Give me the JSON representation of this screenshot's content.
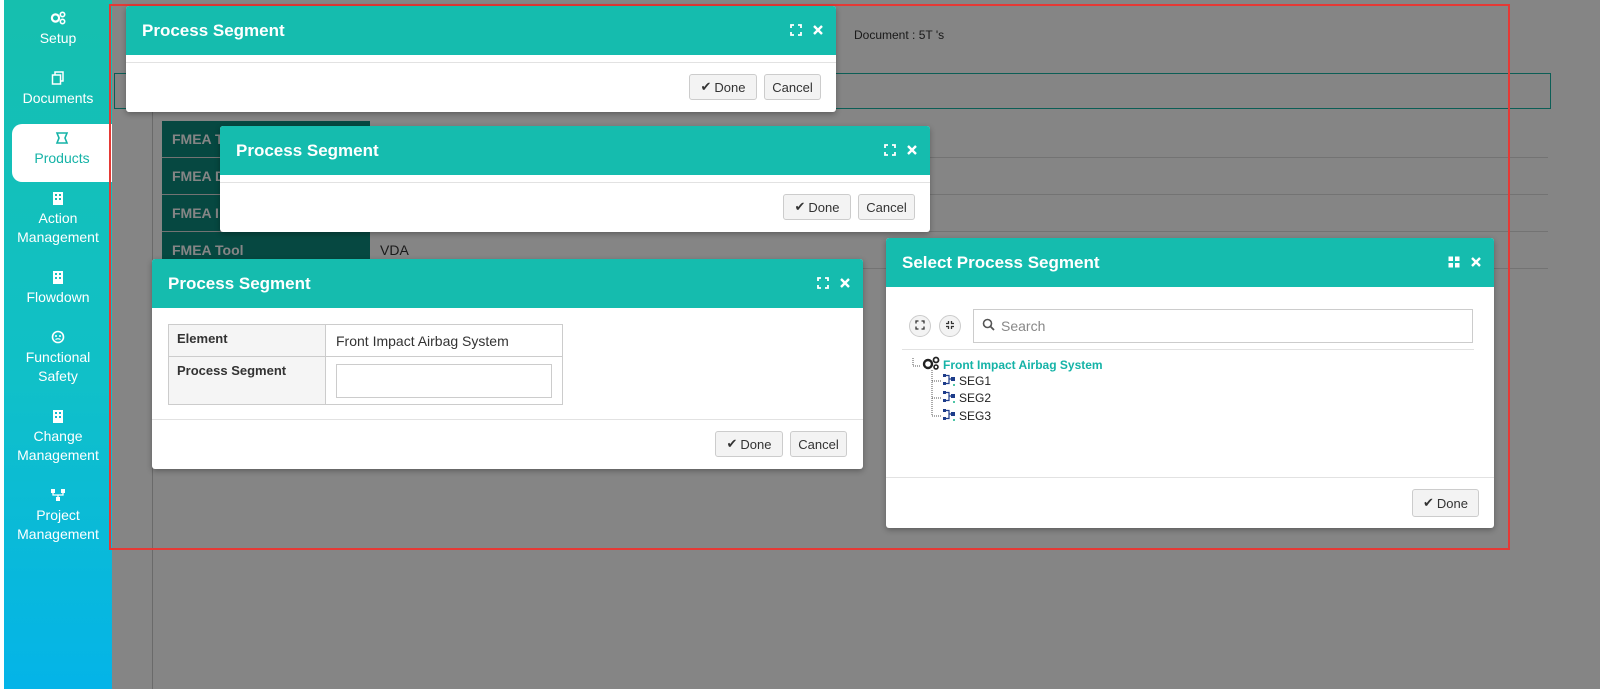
{
  "sidebar": {
    "items": [
      {
        "label": "Setup",
        "icon": "gears-icon"
      },
      {
        "label": "Documents",
        "icon": "copy-icon"
      },
      {
        "label": "Products",
        "icon": "product-icon"
      },
      {
        "label": "Action Management",
        "icon": "building-icon"
      },
      {
        "label": "Flowdown",
        "icon": "building-icon"
      },
      {
        "label": "Functional Safety",
        "icon": "safety-icon"
      },
      {
        "label": "Change Management",
        "icon": "building-icon"
      },
      {
        "label": "Project Management",
        "icon": "sitemap-icon"
      }
    ],
    "active": "Products"
  },
  "background": {
    "document_label": "Document : 5T 's",
    "rows": [
      {
        "label": "FMEA T",
        "value": ""
      },
      {
        "label": "FMEA D",
        "value": ""
      },
      {
        "label": "FMEA I",
        "value": ""
      },
      {
        "label": "FMEA Tool",
        "value": "VDA"
      }
    ]
  },
  "dialogs": {
    "dlg1": {
      "title": "Process Segment",
      "done": "Done",
      "cancel": "Cancel"
    },
    "dlg2": {
      "title": "Process Segment",
      "done": "Done",
      "cancel": "Cancel"
    },
    "dlg3": {
      "title": "Process Segment",
      "element_label": "Element",
      "element_value": "Front Impact Airbag System",
      "segment_label": "Process Segment",
      "segment_value": "",
      "done": "Done",
      "cancel": "Cancel"
    },
    "select": {
      "title": "Select Process Segment",
      "search_placeholder": "Search",
      "root": "Front Impact Airbag System",
      "children": [
        "SEG1",
        "SEG2",
        "SEG3"
      ],
      "done": "Done"
    }
  },
  "colors": {
    "accent": "#15bcae",
    "dark_teal": "#0d8a7e",
    "frame": "#e53935"
  }
}
